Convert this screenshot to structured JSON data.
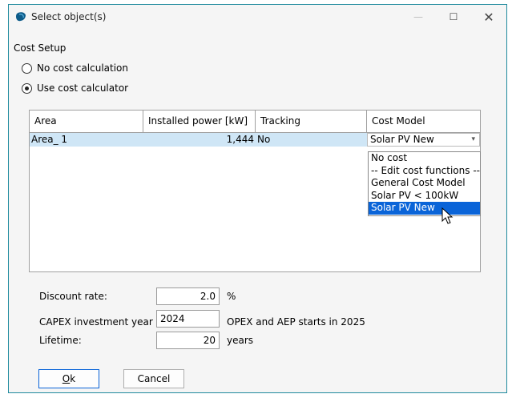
{
  "window": {
    "title": "Select object(s)",
    "min_glyph": "—",
    "max_glyph": "☐",
    "close_glyph": "✕"
  },
  "cost_setup": {
    "section_label": "Cost Setup",
    "options": [
      {
        "label": "No cost calculation",
        "checked": false
      },
      {
        "label": "Use cost calculator",
        "checked": true
      }
    ]
  },
  "table": {
    "columns": [
      "Area",
      "Installed power [kW]",
      "Tracking",
      "Cost Model"
    ],
    "rows": [
      {
        "area": "Area_ 1",
        "installed_power": "1,444",
        "tracking": "No",
        "cost_model": "Solar PV New"
      }
    ]
  },
  "cost_model_dropdown": {
    "options": [
      "No cost",
      "-- Edit cost functions --",
      "General Cost Model",
      "Solar PV < 100kW",
      "Solar PV New"
    ],
    "selected": "Solar PV New"
  },
  "form": {
    "discount_rate_label": "Discount rate:",
    "discount_rate_value": "2.0",
    "discount_rate_unit": "%",
    "capex_label": "CAPEX investment year",
    "capex_value": "2024",
    "capex_note": "OPEX and AEP starts in 2025",
    "lifetime_label": "Lifetime:",
    "lifetime_value": "20",
    "lifetime_unit": "years"
  },
  "buttons": {
    "ok_mnemonic": "O",
    "ok_rest": "k",
    "cancel": "Cancel"
  },
  "colors": {
    "accent": "#0a64d8",
    "window_border": "#1f8a9e",
    "row_highlight": "#cfe6f6"
  }
}
